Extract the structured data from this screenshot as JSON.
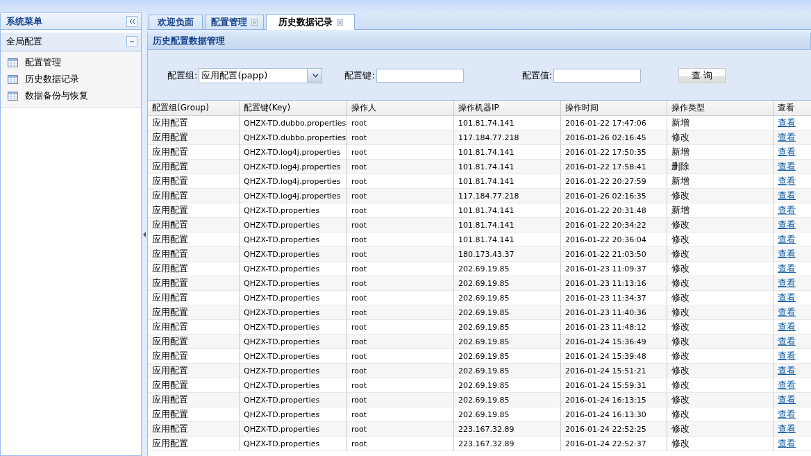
{
  "sidebar": {
    "title": "系统菜单",
    "section": {
      "title": "全局配置",
      "expanded": true
    },
    "items": [
      {
        "label": "配置管理"
      },
      {
        "label": "历史数据记录"
      },
      {
        "label": "数据备份与恢复"
      }
    ]
  },
  "tabs": [
    {
      "label": "欢迎负面",
      "closable": false,
      "selected": false
    },
    {
      "label": "配置管理",
      "closable": true,
      "selected": false
    },
    {
      "label": "历史数据记录",
      "closable": true,
      "selected": true
    }
  ],
  "panel": {
    "title": "历史配置数据管理",
    "filters": {
      "group_label": "配置组:",
      "group_value": "应用配置(papp)",
      "key_label": "配置键:",
      "value_label": "配置值:",
      "query_button": "查 询"
    }
  },
  "table": {
    "columns": [
      "配置组(Group)",
      "配置键(Key)",
      "操作人",
      "操作机器IP",
      "操作时间",
      "操作类型",
      "查看"
    ],
    "rows": [
      [
        "应用配置",
        "QHZX-TD.dubbo.properties",
        "root",
        "101.81.74.141",
        "2016-01-22 17:47:06",
        "新增",
        "查看"
      ],
      [
        "应用配置",
        "QHZX-TD.dubbo.properties",
        "root",
        "117.184.77.218",
        "2016-01-26 02:16:45",
        "修改",
        "查看"
      ],
      [
        "应用配置",
        "QHZX-TD.log4j.properties",
        "root",
        "101.81.74.141",
        "2016-01-22 17:50:35",
        "新增",
        "查看"
      ],
      [
        "应用配置",
        "QHZX-TD.log4j.properties",
        "root",
        "101.81.74.141",
        "2016-01-22 17:58:41",
        "删除",
        "查看"
      ],
      [
        "应用配置",
        "QHZX-TD.log4j.properties",
        "root",
        "101.81.74.141",
        "2016-01-22 20:27:59",
        "新增",
        "查看"
      ],
      [
        "应用配置",
        "QHZX-TD.log4j.properties",
        "root",
        "117.184.77.218",
        "2016-01-26 02:16:35",
        "修改",
        "查看"
      ],
      [
        "应用配置",
        "QHZX-TD.properties",
        "root",
        "101.81.74.141",
        "2016-01-22 20:31:48",
        "新增",
        "查看"
      ],
      [
        "应用配置",
        "QHZX-TD.properties",
        "root",
        "101.81.74.141",
        "2016-01-22 20:34:22",
        "修改",
        "查看"
      ],
      [
        "应用配置",
        "QHZX-TD.properties",
        "root",
        "101.81.74.141",
        "2016-01-22 20:36:04",
        "修改",
        "查看"
      ],
      [
        "应用配置",
        "QHZX-TD.properties",
        "root",
        "180.173.43.37",
        "2016-01-22 21:03:50",
        "修改",
        "查看"
      ],
      [
        "应用配置",
        "QHZX-TD.properties",
        "root",
        "202.69.19.85",
        "2016-01-23 11:09:37",
        "修改",
        "查看"
      ],
      [
        "应用配置",
        "QHZX-TD.properties",
        "root",
        "202.69.19.85",
        "2016-01-23 11:13:16",
        "修改",
        "查看"
      ],
      [
        "应用配置",
        "QHZX-TD.properties",
        "root",
        "202.69.19.85",
        "2016-01-23 11:34:37",
        "修改",
        "查看"
      ],
      [
        "应用配置",
        "QHZX-TD.properties",
        "root",
        "202.69.19.85",
        "2016-01-23 11:40:36",
        "修改",
        "查看"
      ],
      [
        "应用配置",
        "QHZX-TD.properties",
        "root",
        "202.69.19.85",
        "2016-01-23 11:48:12",
        "修改",
        "查看"
      ],
      [
        "应用配置",
        "QHZX-TD.properties",
        "root",
        "202.69.19.85",
        "2016-01-24 15:36:49",
        "修改",
        "查看"
      ],
      [
        "应用配置",
        "QHZX-TD.properties",
        "root",
        "202.69.19.85",
        "2016-01-24 15:39:48",
        "修改",
        "查看"
      ],
      [
        "应用配置",
        "QHZX-TD.properties",
        "root",
        "202.69.19.85",
        "2016-01-24 15:51:21",
        "修改",
        "查看"
      ],
      [
        "应用配置",
        "QHZX-TD.properties",
        "root",
        "202.69.19.85",
        "2016-01-24 15:59:31",
        "修改",
        "查看"
      ],
      [
        "应用配置",
        "QHZX-TD.properties",
        "root",
        "202.69.19.85",
        "2016-01-24 16:13:15",
        "修改",
        "查看"
      ],
      [
        "应用配置",
        "QHZX-TD.properties",
        "root",
        "202.69.19.85",
        "2016-01-24 16:13:30",
        "修改",
        "查看"
      ],
      [
        "应用配置",
        "QHZX-TD.properties",
        "root",
        "223.167.32.89",
        "2016-01-24 22:52:25",
        "修改",
        "查看"
      ],
      [
        "应用配置",
        "QHZX-TD.properties",
        "root",
        "223.167.32.89",
        "2016-01-24 22:52:37",
        "修改",
        "查看"
      ]
    ]
  }
}
